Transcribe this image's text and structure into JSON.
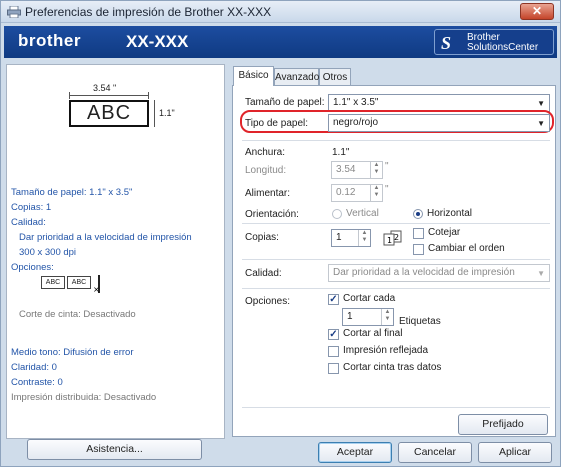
{
  "window": {
    "title": "Preferencias de impresión de Brother XX-XXX",
    "close_glyph": "✕"
  },
  "banner": {
    "brand": "brother",
    "model": "XX-XXX",
    "solutions_l1": "Brother",
    "solutions_l2": "SolutionsCenter"
  },
  "preview": {
    "width_label": "3.54 \"",
    "height_label": "1.1\"",
    "label_text": "ABC"
  },
  "summary": {
    "paper_size": "Tamaño de papel: 1.1\" x 3.5\"",
    "copies": "Copias: 1",
    "quality_heading": "Calidad:",
    "quality_value": "Dar prioridad  a la velocidad de impresión",
    "resolution": "300 x 300 dpi",
    "options_heading": "Opciones:",
    "mini_abc": "ABC",
    "tape_cut": "Corte de cinta: Desactivado",
    "halftone": "Medio tono: Difusión de error",
    "brightness": "Claridad:  0",
    "contrast": "Contraste:  0",
    "distributed": "Impresión distribuida: Desactivado"
  },
  "buttons": {
    "assist": "Asistencia...",
    "default": "Prefijado",
    "ok": "Aceptar",
    "cancel": "Cancelar",
    "apply": "Aplicar"
  },
  "tabs": [
    "Básico",
    "Avanzado",
    "Otros"
  ],
  "basic": {
    "paper_size_label": "Tamaño de papel:",
    "paper_size_value": "1.1\" x 3.5\"",
    "paper_type_label": "Tipo de papel:",
    "paper_type_value": "negro/rojo",
    "width_label": "Anchura:",
    "width_value": "1.1\"",
    "length_label": "Longitud:",
    "length_value": "3.54",
    "length_unit": "\"",
    "feed_label": "Alimentar:",
    "feed_value": "0.12",
    "feed_unit": "\"",
    "orientation_label": "Orientación:",
    "orientation_vertical": "Vertical",
    "orientation_horizontal": "Horizontal",
    "orientation_selected": "Horizontal",
    "copies_label": "Copias:",
    "copies_value": "1",
    "collate_label": "Cotejar",
    "reverse_label": "Cambiar el orden",
    "quality_label": "Calidad:",
    "quality_value": "Dar prioridad  a la velocidad de impresión",
    "options_label": "Opciones:",
    "cut_every_label": "Cortar cada",
    "cut_every_value": "1",
    "labels_label": "Etiquetas",
    "cut_at_end_label": "Cortar al final",
    "mirror_label": "Impresión reflejada",
    "cut_tape_label": "Cortar cinta tras datos",
    "cut_every_checked": true,
    "cut_at_end_checked": true,
    "mirror_checked": false,
    "cut_tape_checked": false,
    "collate_checked": false,
    "reverse_checked": false
  },
  "colors": {
    "highlight": "#e0242a",
    "banner": "#1d4da0",
    "summary_text": "#2355a8"
  },
  "icons": [
    "printer-icon",
    "close-icon",
    "solutions-center-logo",
    "dropdown-arrow-icon",
    "spin-arrows-icon",
    "collate-pages-icon",
    "check-icon"
  ]
}
